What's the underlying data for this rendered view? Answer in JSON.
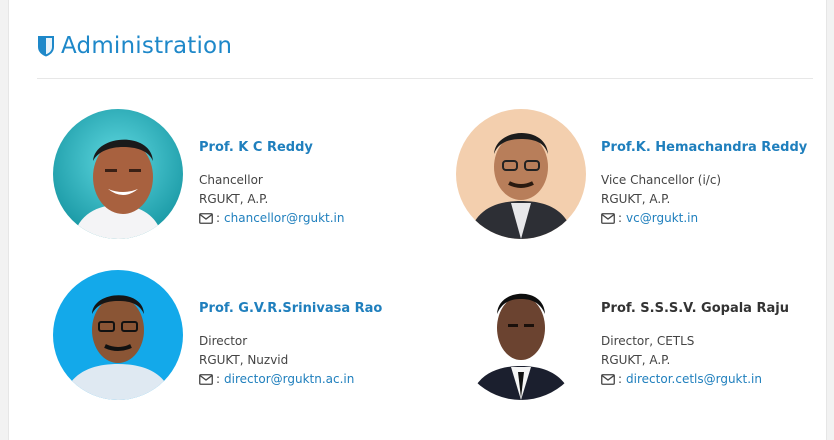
{
  "section": {
    "title": "Administration",
    "icon": "shield-icon",
    "accent_color": "#1e88c9"
  },
  "people": [
    {
      "name": "Prof. K C Reddy",
      "role": "Chancellor",
      "org": "RGUKT, A.P.",
      "email_prefix": ":",
      "email": "chancellor@rgukt.in",
      "photo_bg": "#1cb3c8"
    },
    {
      "name": "Prof.K. Hemachandra Reddy",
      "role": "Vice Chancellor (i/c)",
      "org": "RGUKT, A.P.",
      "email_prefix": ":",
      "email": "vc@rgukt.in",
      "photo_bg": "#f2c9a5"
    },
    {
      "name": "Prof. G.V.R.Srinivasa Rao",
      "role": "Director",
      "org": "RGUKT, Nuzvid",
      "email_prefix": ":",
      "email": "director@rguktn.ac.in",
      "photo_bg": "#13a9ea"
    },
    {
      "name": "Prof. S.S.S.V. Gopala Raju",
      "role": "Director, CETLS",
      "org": "RGUKT, A.P.",
      "email_prefix": ":",
      "email": "director.cetls@rgukt.in",
      "photo_bg": "#ffffff"
    }
  ]
}
